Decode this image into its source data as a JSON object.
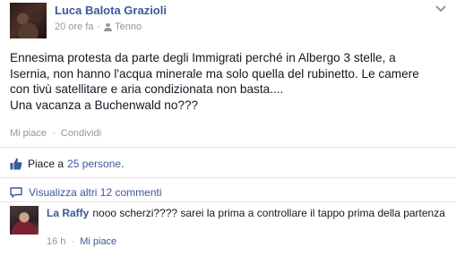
{
  "post": {
    "author": "Luca Balota Grazioli",
    "time": "20 ore fa",
    "separator": "·",
    "audience": "Tenno",
    "body_lines": [
      "Ennesima protesta da parte degli Immigrati perché in Albergo 3 stelle, a",
      "Isernia, non hanno l'acqua minerale ma solo quella del rubinetto. Le camere",
      "con tivù satellitare e aria condizionata non basta....",
      "Una vacanza a Buchenwald no???"
    ]
  },
  "actions": {
    "like": "Mi piace",
    "separator": "·",
    "share": "Condividi"
  },
  "likes": {
    "prefix": "Piace a",
    "link": "25 persone",
    "suffix": "."
  },
  "comments": {
    "view_more": "Visualizza altri 12 commenti",
    "items": [
      {
        "author": "La Raffy",
        "text": "nooo scherzi???? sarei la prima a controllare il tappo prima della partenza",
        "time": "16 h",
        "separator": "·",
        "like": "Mi piace"
      }
    ]
  },
  "icons": {
    "options": "chevron-down-icon",
    "audience": "people-icon",
    "likes": "thumbs-up-icon",
    "comments": "comment-bubble-icon"
  },
  "colors": {
    "link": "#3b5998",
    "meta": "#9197a3",
    "text": "#141823",
    "divider": "#e5e5e5"
  }
}
